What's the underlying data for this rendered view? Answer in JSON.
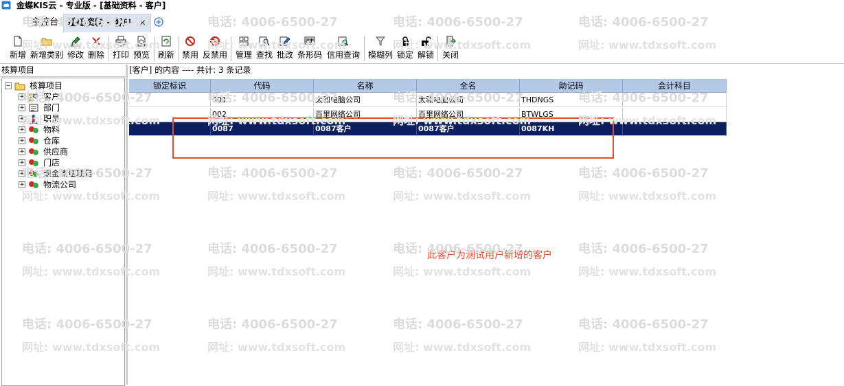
{
  "window": {
    "title": "金蝶KIS云 - 专业版 - [基础资料 - 客户]"
  },
  "tabs": [
    {
      "label": "主控台"
    },
    {
      "label": "基础资料 - 客户",
      "close": "×"
    }
  ],
  "toolbar": {
    "new": "新增",
    "new_category": "新增类别",
    "edit": "修改",
    "delete": "删除",
    "print": "打印",
    "preview": "预览",
    "refresh": "刷新",
    "disable": "禁用",
    "enable": "反禁用",
    "manage": "管理",
    "find": "查找",
    "batch_edit": "批改",
    "barcode": "条形码",
    "credit_query": "信用查询",
    "fuzzy_column": "模糊列",
    "lock": "锁定",
    "unlock": "解锁",
    "close": "关闭"
  },
  "left_panel": {
    "header": "核算项目",
    "tree": {
      "root": "核算项目",
      "items": [
        "客户",
        "部门",
        "职员",
        "物料",
        "仓库",
        "供应商",
        "门店",
        "现金流量项目",
        "物流公司"
      ]
    }
  },
  "content": {
    "header": "[客户] 的内容 ---- 共计: 3 条记录",
    "columns": [
      "锁定标识",
      "代码",
      "名称",
      "全名",
      "助记码",
      "会计科目"
    ],
    "rows": [
      [
        "",
        "001",
        "太和电脑公司",
        "太和电脑公司",
        "THDNGS",
        ""
      ],
      [
        "",
        "002",
        "百里网络公司",
        "百里网络公司",
        "BTWLGS",
        ""
      ],
      [
        "",
        "0087",
        "0087客户",
        "0087客户",
        "0087KH",
        ""
      ]
    ]
  },
  "annotation": {
    "text": "此客户为测试用户新增的客户"
  },
  "watermark": {
    "phone": "电话: 4006-6500-27",
    "site": "网址: www.tdxsoft.com"
  },
  "colors": {
    "header_blue": "#b4c9e6",
    "selection": "#0d1f5e",
    "annotation_red": "#e84a2c"
  }
}
